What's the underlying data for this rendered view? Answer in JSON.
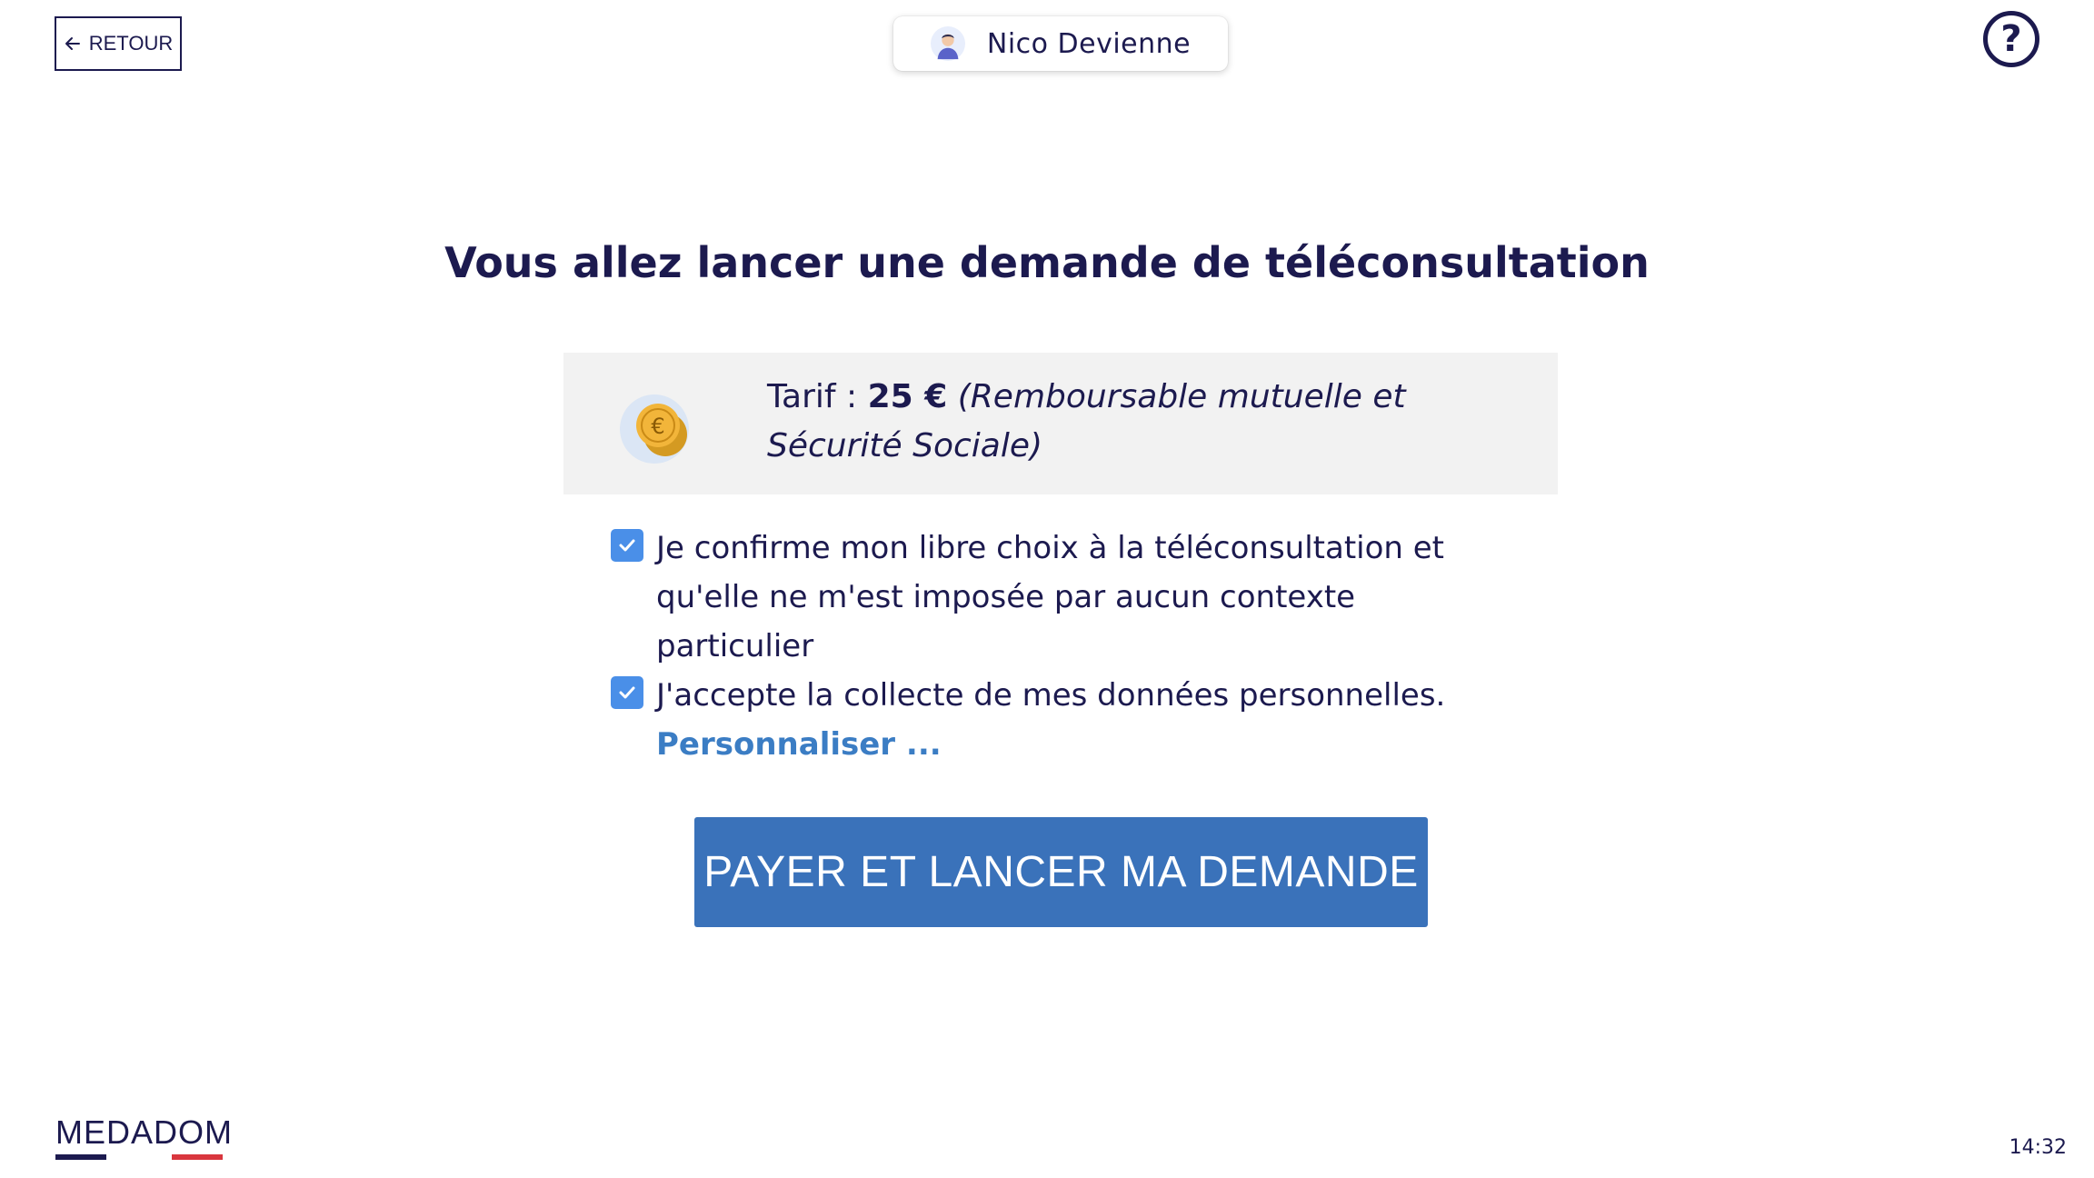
{
  "header": {
    "back_label": "RETOUR",
    "user_name": "Nico Devienne",
    "help_symbol": "?"
  },
  "main": {
    "title": "Vous allez lancer une demande de téléconsultation",
    "tariff": {
      "label": "Tarif :",
      "price": "25 €",
      "note": "(Remboursable mutuelle et Sécurité Sociale)"
    },
    "consents": [
      {
        "text": "Je confirme mon libre choix à la téléconsultation et qu'elle ne m'est imposée par aucun contexte particulier",
        "checked": true
      },
      {
        "text": "J'accepte la collecte de mes données personnelles.",
        "checked": true,
        "link": "Personnaliser ..."
      }
    ],
    "pay_button": "PAYER ET LANCER MA DEMANDE"
  },
  "footer": {
    "logo": "MEDADOM",
    "time": "14:32"
  },
  "icons": {
    "back": "arrow-left-icon",
    "avatar": "user-avatar-icon",
    "help": "question-mark-icon",
    "coin": "euro-coin-icon",
    "check": "checkmark-icon"
  },
  "colors": {
    "navy": "#1c1a4f",
    "primary_button": "#3a72ba",
    "checkbox": "#4a8fe8",
    "link": "#3b7dc4",
    "panel": "#f2f2f2",
    "logo_red": "#d9363e"
  }
}
